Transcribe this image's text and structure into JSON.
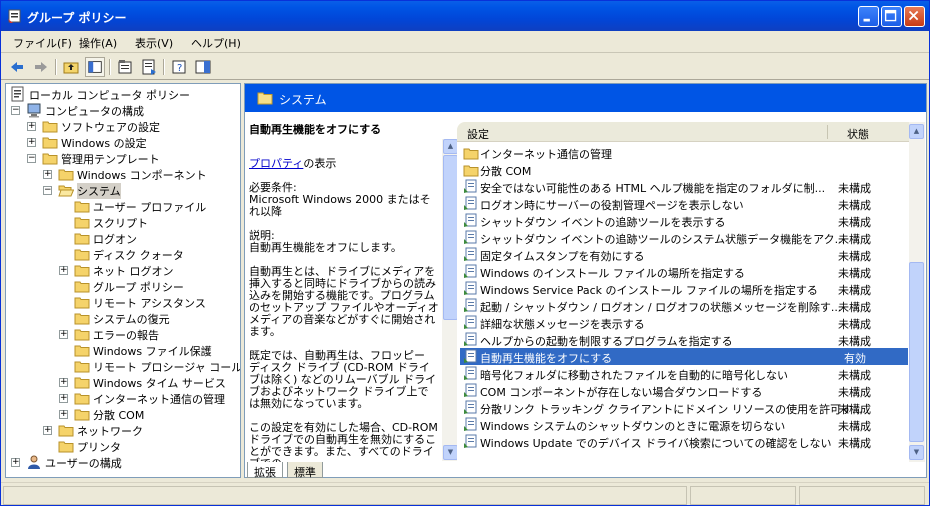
{
  "window": {
    "title": "グループ ポリシー"
  },
  "menu": [
    "ファイル(F)",
    "操作(A)",
    "表示(V)",
    "ヘルプ(H)"
  ],
  "tree": [
    {
      "label": "ローカル コンピュータ ポリシー",
      "icon": "computer-policy-icon",
      "level": 0,
      "expander": ""
    },
    {
      "label": "コンピュータの構成",
      "icon": "computer-icon",
      "level": 1,
      "expander": "-"
    },
    {
      "label": "ソフトウェアの設定",
      "icon": "folder-icon",
      "level": 2,
      "expander": "+"
    },
    {
      "label": "Windows の設定",
      "icon": "folder-icon",
      "level": 2,
      "expander": "+"
    },
    {
      "label": "管理用テンプレート",
      "icon": "folder-icon",
      "level": 2,
      "expander": "-"
    },
    {
      "label": "Windows コンポーネント",
      "icon": "folder-icon",
      "level": 3,
      "expander": "+"
    },
    {
      "label": "システム",
      "icon": "folder-open-icon",
      "level": 3,
      "expander": "-",
      "selected": true
    },
    {
      "label": "ユーザー プロファイル",
      "icon": "folder-icon",
      "level": 4,
      "expander": ""
    },
    {
      "label": "スクリプト",
      "icon": "folder-icon",
      "level": 4,
      "expander": ""
    },
    {
      "label": "ログオン",
      "icon": "folder-icon",
      "level": 4,
      "expander": ""
    },
    {
      "label": "ディスク クォータ",
      "icon": "folder-icon",
      "level": 4,
      "expander": ""
    },
    {
      "label": "ネット ログオン",
      "icon": "folder-icon",
      "level": 4,
      "expander": "+"
    },
    {
      "label": "グループ ポリシー",
      "icon": "folder-icon",
      "level": 4,
      "expander": ""
    },
    {
      "label": "リモート アシスタンス",
      "icon": "folder-icon",
      "level": 4,
      "expander": ""
    },
    {
      "label": "システムの復元",
      "icon": "folder-icon",
      "level": 4,
      "expander": ""
    },
    {
      "label": "エラーの報告",
      "icon": "folder-icon",
      "level": 4,
      "expander": "+"
    },
    {
      "label": "Windows ファイル保護",
      "icon": "folder-icon",
      "level": 4,
      "expander": ""
    },
    {
      "label": "リモート プロシージャ コール",
      "icon": "folder-icon",
      "level": 4,
      "expander": ""
    },
    {
      "label": "Windows タイム サービス",
      "icon": "folder-icon",
      "level": 4,
      "expander": "+"
    },
    {
      "label": "インターネット通信の管理",
      "icon": "folder-icon",
      "level": 4,
      "expander": "+"
    },
    {
      "label": "分散 COM",
      "icon": "folder-icon",
      "level": 4,
      "expander": "+"
    },
    {
      "label": "ネットワーク",
      "icon": "folder-icon",
      "level": 3,
      "expander": "+"
    },
    {
      "label": "プリンタ",
      "icon": "folder-icon",
      "level": 3,
      "expander": ""
    },
    {
      "label": "ユーザーの構成",
      "icon": "user-icon",
      "level": 1,
      "expander": "+"
    }
  ],
  "panel": {
    "title": "システム"
  },
  "description": {
    "heading": "自動再生機能をオフにする",
    "link": "プロパティ",
    "link_suffix": "の表示",
    "requirements": "必要条件:\nMicrosoft Windows 2000 またはそれ以降",
    "explain": "説明:\n自動再生機能をオフにします。",
    "body1": "自動再生とは、ドライブにメディアを挿入すると同時にドライブからの読み込みを開始する機能です。プログラムのセットアップ ファイルやオーディオ メディアの音楽などがすぐに開始されます。",
    "body2": "既定では、自動再生は、フロッピー ディスク ドライブ (CD-ROM ドライブは除く) などのリムーバブル ドライブおよびネットワーク ドライブ上では無効になっています。",
    "body3": "この設定を有効にした場合、CD-ROM ドライブでの自動再生を無効にすることができます。また、すべてのドライブでの"
  },
  "list": {
    "col_setting": "設定",
    "col_state": "状態",
    "rows": [
      {
        "name": "インターネット通信の管理",
        "state": "",
        "icon": "folder-icon"
      },
      {
        "name": "分散 COM",
        "state": "",
        "icon": "folder-icon"
      },
      {
        "name": "安全ではない可能性のある HTML ヘルプ機能を指定のフォルダに制...",
        "state": "未構成",
        "icon": "policy-icon"
      },
      {
        "name": "ログオン時にサーバーの役割管理ページを表示しない",
        "state": "未構成",
        "icon": "policy-icon"
      },
      {
        "name": "シャットダウン イベントの追跡ツールを表示する",
        "state": "未構成",
        "icon": "policy-icon"
      },
      {
        "name": "シャットダウン イベントの追跡ツールのシステム状態データ機能をアク...",
        "state": "未構成",
        "icon": "policy-icon"
      },
      {
        "name": "固定タイムスタンプを有効にする",
        "state": "未構成",
        "icon": "policy-icon"
      },
      {
        "name": "Windows のインストール ファイルの場所を指定する",
        "state": "未構成",
        "icon": "policy-icon"
      },
      {
        "name": "Windows Service Pack のインストール ファイルの場所を指定する",
        "state": "未構成",
        "icon": "policy-icon"
      },
      {
        "name": "起動 / シャットダウン / ログオン / ログオフの状態メッセージを削除す...",
        "state": "未構成",
        "icon": "policy-icon"
      },
      {
        "name": "詳細な状態メッセージを表示する",
        "state": "未構成",
        "icon": "policy-icon"
      },
      {
        "name": "ヘルプからの起動を制限するプログラムを指定する",
        "state": "未構成",
        "icon": "policy-icon"
      },
      {
        "name": "自動再生機能をオフにする",
        "state": "有効",
        "icon": "policy-icon",
        "selected": true
      },
      {
        "name": "暗号化フォルダに移動されたファイルを自動的に暗号化しない",
        "state": "未構成",
        "icon": "policy-icon"
      },
      {
        "name": "COM コンポーネントが存在しない場合ダウンロードする",
        "state": "未構成",
        "icon": "policy-icon"
      },
      {
        "name": "分散リンク トラッキング クライアントにドメイン リソースの使用を許可す...",
        "state": "未構成",
        "icon": "policy-icon"
      },
      {
        "name": "Windows システムのシャットダウンのときに電源を切らない",
        "state": "未構成",
        "icon": "policy-icon"
      },
      {
        "name": "Windows Update でのデバイス ドライバ検索についての確認をしない",
        "state": "未構成",
        "icon": "policy-icon"
      }
    ]
  },
  "tabs": [
    "拡張",
    "標準"
  ],
  "colors": {
    "titlebar": "#0055e5",
    "selection": "#316ac5",
    "panel_header": "#0055e5"
  }
}
